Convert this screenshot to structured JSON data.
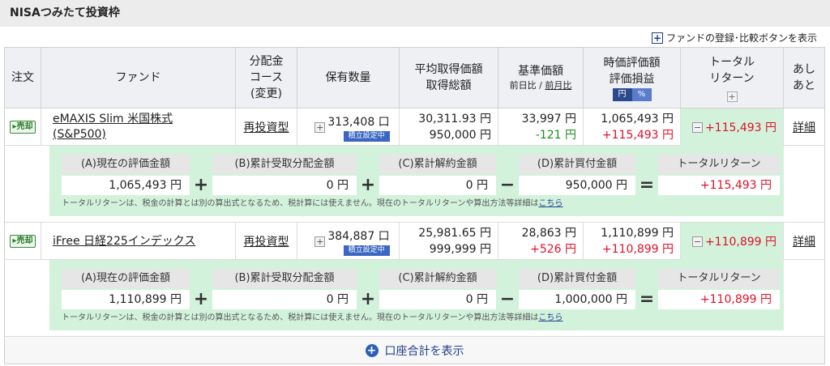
{
  "section_title": "NISAつみたて投資枠",
  "register_label": "ファンドの登録･比較ボタンを表示",
  "headers": {
    "order": "注文",
    "fund": "ファンド",
    "dist1": "分配金",
    "dist2": "コース",
    "dist3": "(変更)",
    "qty": "保有数量",
    "avg1": "平均取得価額",
    "avg2": "取得総額",
    "base": "基準価額",
    "base_sub_a": "前日比",
    "base_sub_sep": " / ",
    "base_sub_b": "前月比",
    "mv1": "時価評価額",
    "mv2": "評価損益",
    "yen": "円",
    "pct": "%",
    "tr1": "トータル",
    "tr2": "リターン",
    "ash1": "あし",
    "ash2": "あと"
  },
  "rows": [
    {
      "sell": "▸売却",
      "fund_line1": "eMAXIS Slim 米国株式",
      "fund_line2": "(S&P500)",
      "course": "再投資型",
      "qty": "313,408 口",
      "tsumitate": "積立設定中",
      "avg_price": "30,311.93 円",
      "total_cost": "950,000 円",
      "base_price": "33,997 円",
      "change": "-121 円",
      "market_value": "1,065,493 円",
      "gain": "+115,493 円",
      "total_return": "+115,493 円",
      "detail": "詳細",
      "breakdown": {
        "a_label": "(A)現在の評価金額",
        "a_value": "1,065,493 円",
        "b_label": "(B)累計受取分配金額",
        "b_value": "0 円",
        "c_label": "(C)累計解約金額",
        "c_value": "0 円",
        "d_label": "(D)累計買付金額",
        "d_value": "950,000 円",
        "tr_label": "トータルリターン",
        "tr_value": "+115,493 円"
      }
    },
    {
      "sell": "▸売却",
      "fund_line1": "iFree 日経225インデックス",
      "fund_line2": "",
      "course": "再投資型",
      "qty": "384,887 口",
      "tsumitate": "積立設定中",
      "avg_price": "25,981.65 円",
      "total_cost": "999,999 円",
      "base_price": "28,863 円",
      "change": "+526 円",
      "market_value": "1,110,899 円",
      "gain": "+110,899 円",
      "total_return": "+110,899 円",
      "detail": "詳細",
      "breakdown": {
        "a_label": "(A)現在の評価金額",
        "a_value": "1,110,899 円",
        "b_label": "(B)累計受取分配金額",
        "b_value": "0 円",
        "c_label": "(C)累計解約金額",
        "c_value": "0 円",
        "d_label": "(D)累計買付金額",
        "d_value": "1,000,000 円",
        "tr_label": "トータルリターン",
        "tr_value": "+110,899 円"
      }
    }
  ],
  "ops": {
    "plus": "+",
    "minus": "−",
    "equals": "="
  },
  "note_text": "トータルリターンは、税金の計算とは別の算出式となるため、税計算には使えません。現在のトータルリターンや算出方法等詳細は",
  "note_link": "こちら",
  "footer_label": "口座合計を表示",
  "colors": {
    "gain": "#e0102a",
    "loss": "#1a8f1a",
    "breakdown_bg": "#d2f2dc",
    "accent": "#2b4a8d"
  }
}
